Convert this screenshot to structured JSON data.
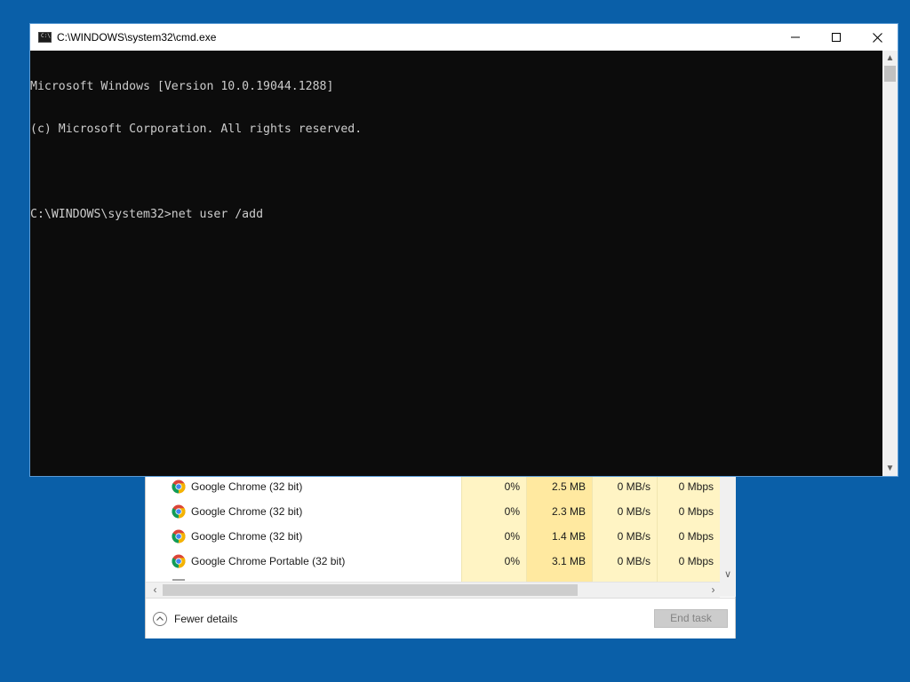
{
  "cmd_window": {
    "title": "C:\\WINDOWS\\system32\\cmd.exe",
    "icon": "cmd-console-icon",
    "controls": {
      "minimize": "minimize-icon",
      "maximize": "maximize-icon",
      "close": "close-icon"
    },
    "console_lines": [
      "Microsoft Windows [Version 10.0.19044.1288]",
      "(c) Microsoft Corporation. All rights reserved.",
      "",
      "C:\\WINDOWS\\system32>net user /add"
    ],
    "text_color": "#cccccc",
    "background_color": "#0c0c0c"
  },
  "task_manager": {
    "rows": [
      {
        "icon": "chrome-icon",
        "name": "Google Chrome (32 bit)",
        "cpu": "0%",
        "memory": "2.5 MB",
        "disk": "0 MB/s",
        "network": "0 Mbps"
      },
      {
        "icon": "chrome-icon",
        "name": "Google Chrome (32 bit)",
        "cpu": "0%",
        "memory": "2.3 MB",
        "disk": "0 MB/s",
        "network": "0 Mbps"
      },
      {
        "icon": "chrome-icon",
        "name": "Google Chrome (32 bit)",
        "cpu": "0%",
        "memory": "1.4 MB",
        "disk": "0 MB/s",
        "network": "0 Mbps"
      },
      {
        "icon": "chrome-icon",
        "name": "Google Chrome Portable (32 bit)",
        "cpu": "0%",
        "memory": "3.1 MB",
        "disk": "0 MB/s",
        "network": "0 Mbps"
      }
    ],
    "footer": {
      "fewer_details_label": "Fewer details",
      "end_task_label": "End task"
    },
    "heat_colors": {
      "light": "#fff4c4",
      "medium": "#ffe9a0"
    }
  },
  "desktop": {
    "background_color": "#0a5fa8"
  }
}
